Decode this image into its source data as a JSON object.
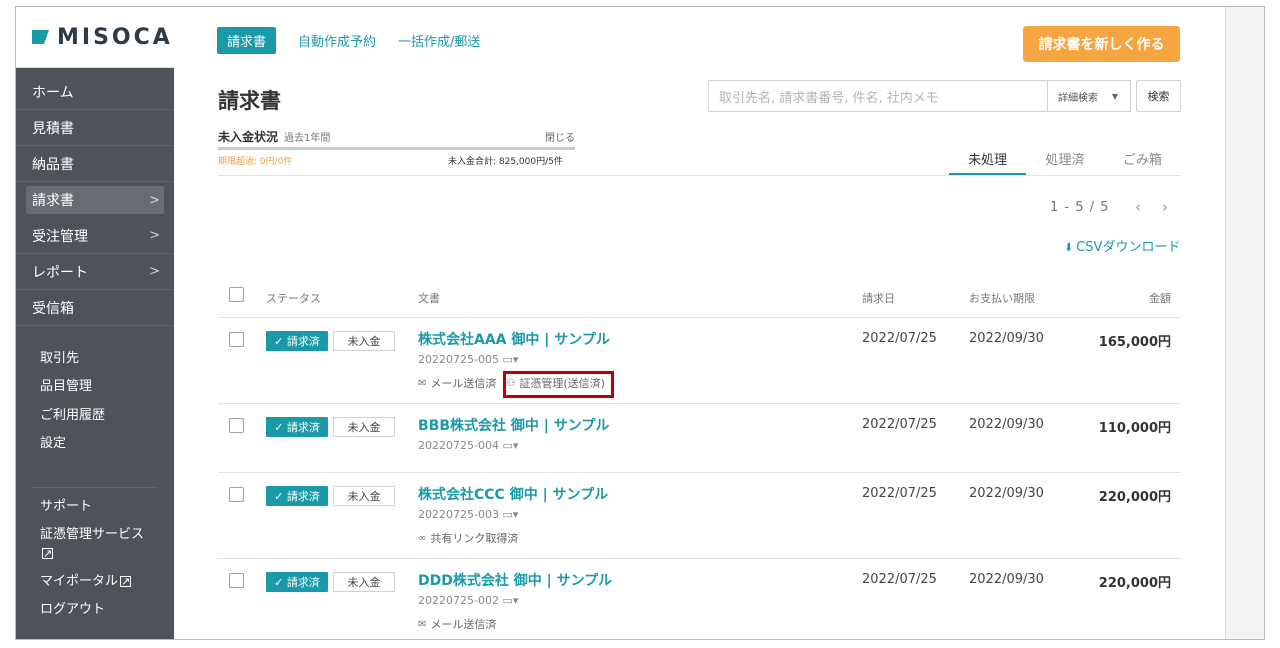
{
  "brand": {
    "name": "MISOCA",
    "color": "#1a9aa8"
  },
  "sidebar": {
    "items": [
      {
        "label": "ホーム",
        "has_chevron": false
      },
      {
        "label": "見積書",
        "has_chevron": false
      },
      {
        "label": "納品書",
        "has_chevron": false
      },
      {
        "label": "請求書",
        "has_chevron": true,
        "active": true
      },
      {
        "label": "受注管理",
        "has_chevron": true
      },
      {
        "label": "レポート",
        "has_chevron": true
      },
      {
        "label": "受信箱",
        "has_chevron": false
      }
    ],
    "sub_items": [
      "取引先",
      "品目管理",
      "ご利用履歴",
      "設定"
    ],
    "bottom_items": [
      {
        "label": "サポート"
      },
      {
        "label": "証憑管理サービス",
        "external": true
      },
      {
        "label": "マイポータル",
        "external": true
      },
      {
        "label": "ログアウト"
      }
    ],
    "chevron": ">",
    "external_glyph": "⧉"
  },
  "header": {
    "tabs": [
      "請求書",
      "自動作成予約",
      "一括作成/郵送"
    ],
    "new_button": "請求書を新しく作る",
    "title": "請求書"
  },
  "search": {
    "placeholder": "取引先名, 請求書番号, 件名, 社内メモ",
    "advanced_label": "詳細検索",
    "button_label": "検索"
  },
  "unpaid_summary": {
    "title": "未入金状況",
    "period": "過去1年間",
    "close_label": "閉じる",
    "overdue": "期限超過: 0円/0件",
    "total": "未入金合計: 825,000円/5件"
  },
  "status_tabs": [
    "未処理",
    "処理済",
    "ごみ箱"
  ],
  "pager": {
    "range": "1 - 5 / 5",
    "prev": "‹",
    "next": "›"
  },
  "csv": {
    "icon": "⬇",
    "label": "CSVダウンロード"
  },
  "table": {
    "headers": {
      "status": "ステータス",
      "document": "文書",
      "billing_date": "請求日",
      "due_date": "お支払い期限",
      "amount": "金額"
    },
    "rows": [
      {
        "status_paid": "✓ 請求済",
        "status_unpaid": "未入金",
        "title": "株式会社AAA 御中 | サンプル",
        "number": "20220725-005 ▭▾",
        "notes": [
          {
            "icon": "✉",
            "text": "メール送信済"
          },
          {
            "icon": "⚇",
            "text": "証憑管理(送信済)"
          }
        ],
        "billing_date": "2022/07/25",
        "due_date": "2022/09/30",
        "amount": "165,000円"
      },
      {
        "status_paid": "✓ 請求済",
        "status_unpaid": "未入金",
        "title": "BBB株式会社 御中 | サンプル",
        "number": "20220725-004 ▭▾",
        "notes": [],
        "billing_date": "2022/07/25",
        "due_date": "2022/09/30",
        "amount": "110,000円"
      },
      {
        "status_paid": "✓ 請求済",
        "status_unpaid": "未入金",
        "title": "株式会社CCC 御中 | サンプル",
        "number": "20220725-003 ▭▾",
        "notes": [
          {
            "icon": "∞",
            "text": "共有リンク取得済"
          }
        ],
        "billing_date": "2022/07/25",
        "due_date": "2022/09/30",
        "amount": "220,000円"
      },
      {
        "status_paid": "✓ 請求済",
        "status_unpaid": "未入金",
        "title": "DDD株式会社 御中 | サンプル",
        "number": "20220725-002 ▭▾",
        "notes": [
          {
            "icon": "✉",
            "text": "メール送信済"
          }
        ],
        "billing_date": "2022/07/25",
        "due_date": "2022/09/30",
        "amount": "220,000円"
      }
    ]
  },
  "colors": {
    "accent": "#1a9aa8",
    "orange": "#f7a541",
    "sidebar_bg": "#4d5359",
    "highlight": "#c00000"
  }
}
